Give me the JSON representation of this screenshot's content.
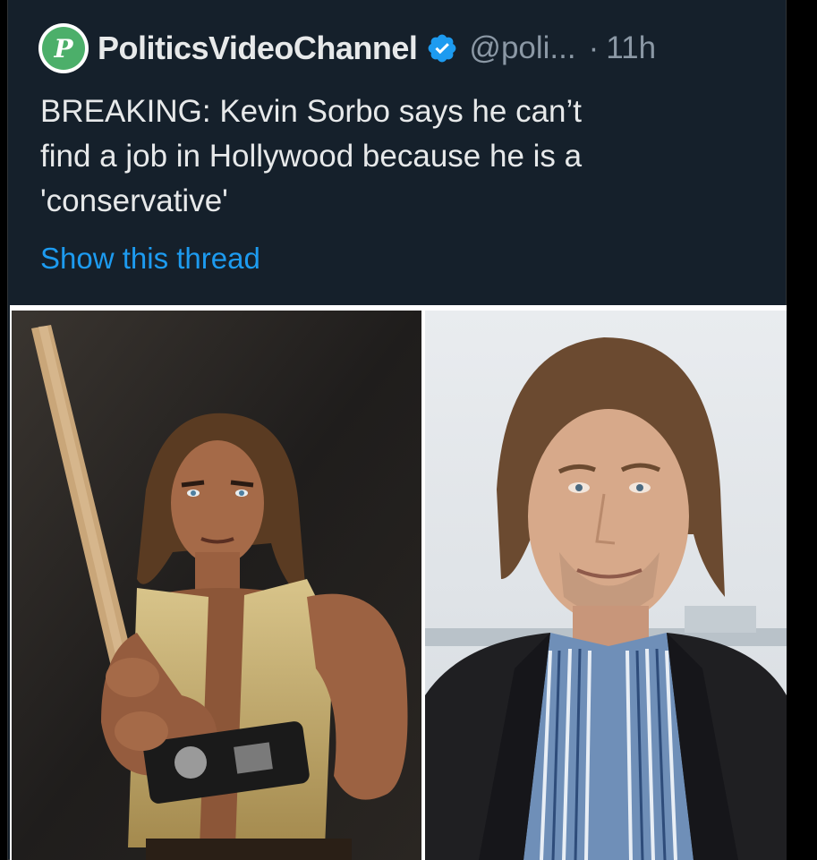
{
  "tweet": {
    "display_name": "PoliticsVideoChannel",
    "handle": "@poli...",
    "separator": "·",
    "time": "11h",
    "text": "BREAKING: Kevin Sorbo says he can’t\nfind a job in Hollywood because he is a\n'conservative'",
    "show_thread_label": "Show this thread",
    "avatar_letter": "P"
  },
  "colors": {
    "background": "#15202b",
    "text": "#e7e9ea",
    "secondary": "#8b98a5",
    "link": "#1d9bf0",
    "verified": "#1d9bf0"
  },
  "icons": {
    "verified": "verified-badge-icon"
  }
}
